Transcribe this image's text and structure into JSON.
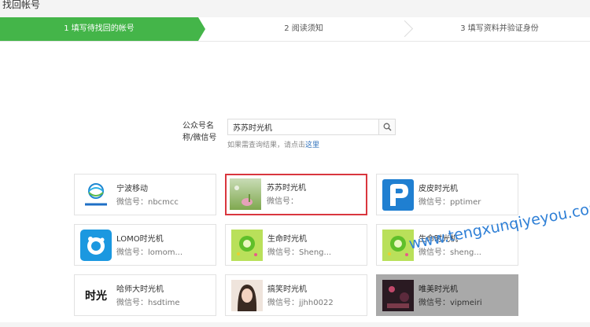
{
  "page_title": "找回帐号",
  "steps": [
    {
      "label": "1 填写待找回的帐号",
      "active": true
    },
    {
      "label": "2 阅读须知",
      "active": false
    },
    {
      "label": "3 填写资料并验证身份",
      "active": false
    }
  ],
  "search": {
    "label": "公众号名称/微信号",
    "value": "苏苏时光机",
    "hint_prefix": "如果需查询结果，请点击",
    "hint_link": "这里"
  },
  "accounts": [
    {
      "name": "宁波移动",
      "wechat": "微信号：nbcmcc",
      "avatar": "ningbo-mobile-logo"
    },
    {
      "name": "苏苏时光机",
      "wechat": "微信号：",
      "avatar": "photo-green",
      "selected": true
    },
    {
      "name": "皮皮时光机",
      "wechat": "微信号：pptimer",
      "avatar": "blue-p-logo"
    },
    {
      "name": "LOMO时光机",
      "wechat": "微信号：lomom...",
      "avatar": "blue-cloud-logo"
    },
    {
      "name": "生命时光机",
      "wechat": "微信号：Sheng...",
      "avatar": "green-clock-logo"
    },
    {
      "name": "生命时光机",
      "wechat": "微信号：sheng...",
      "avatar": "green-clock-logo"
    },
    {
      "name": "哈师大时光机",
      "wechat": "微信号：hsdtime",
      "avatar": "calligraphy-logo",
      "avatar_text": "时光"
    },
    {
      "name": "搞笑时光机",
      "wechat": "微信号：jjhh0022",
      "avatar": "portrait-photo"
    },
    {
      "name": "唯美时光机",
      "wechat": "微信号：vipmeiri",
      "avatar": "night-photo",
      "grey": true
    }
  ],
  "watermark": "www.tengxunqiyeyou.com"
}
